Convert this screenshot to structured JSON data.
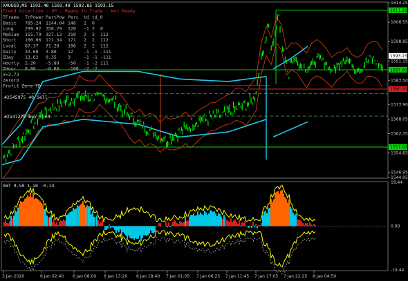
{
  "header": {
    "title": "XAUUSD,M5  1593.46 1593.48 1592.85 1593.15",
    "trend_status": "Trend Direction : UP  ;  Ready To Trade : Not Ready"
  },
  "stats_table": {
    "headers": [
      "TFrame",
      "TrPower",
      "PartPow",
      "Perc",
      "td",
      "td_0"
    ],
    "rows": [
      [
        "Basic",
        "785.24",
        "1144.04",
        "146",
        "2",
        "0"
      ],
      [
        "Long",
        "299.92",
        "358.79",
        "120",
        "-1",
        "2",
        "0"
      ],
      [
        "Medium",
        "155.79",
        "327.13",
        "210",
        "2",
        "2",
        "112"
      ],
      [
        "Short",
        "100.06",
        "171.34",
        "171",
        "2",
        "2",
        "112"
      ],
      [
        "Local",
        "67.37",
        "71.28",
        "106",
        "2",
        "2",
        "112"
      ],
      [
        "Daily",
        "33.68",
        "3.80",
        "12",
        "-1",
        "-1",
        "-111"
      ],
      [
        "IDay",
        "13.62",
        "0.35",
        "3",
        "-1",
        "-1",
        "-111"
      ],
      [
        "Hourly",
        "2.20",
        "-5.89",
        "-50",
        "-1",
        "-2",
        "111"
      ],
      [
        "IHour",
        "0.86",
        "-0.86",
        "-100",
        "-2",
        "-2",
        ""
      ]
    ],
    "extra_lines": [
      "V=3.73",
      "ZeroTD",
      "Profit Zero TD"
    ]
  },
  "chart_notes": [
    "#2545975 40 Sell",
    "#2547279 Buy 0.04"
  ],
  "colors": {
    "background": "#000000",
    "price": "#00ff00",
    "channel": "#1ec8e6",
    "level_green": "#00e000",
    "level_red": "#e02020",
    "bands": "#c83c14",
    "osc_cyan": "#00c8e6",
    "osc_orange": "#ff6400",
    "osc_red": "#e01e1e",
    "osc_yellow": "#ffff00"
  },
  "price_axis": {
    "ticks": [
      "1614.25",
      "1606.55",
      "1598.85",
      "1591.15",
      "1583.50",
      "1573.90",
      "1568.05",
      "1562.35",
      "1554.65",
      "1546.95",
      "1544.95"
    ],
    "labels": [
      {
        "text": "1611.29",
        "value": 1611.29,
        "color": "#00e000"
      },
      {
        "text": "1593.15",
        "value": 1593.15,
        "color": "#ffffff"
      },
      {
        "text": "1587.65",
        "value": 1587.65,
        "color": "#00e000"
      },
      {
        "text": "1580.00",
        "value": 1580.0,
        "color": "#e02020"
      },
      {
        "text": "1557.00",
        "value": 1557.0,
        "color": "#00e000"
      }
    ],
    "ylim": [
      1544.95,
      1614.25
    ]
  },
  "oscillator": {
    "title": "SWT 9.50 1.10 -0.14",
    "axis_ticks": [
      "19.44",
      "0.00",
      "-19.44"
    ],
    "ylim": [
      -19.44,
      19.44
    ]
  },
  "time_axis": {
    "labels": [
      "3 Jan 2020",
      "6 Jan 02:40",
      "6 Jan 08:00",
      "6 Jan 13:20",
      "6 Jan 18:40",
      "7 Jan 01:05",
      "7 Jan 06:25",
      "7 Jan 11:45",
      "7 Jan 17:05",
      "7 Jan 22:25",
      "8 Jan 04:50"
    ]
  },
  "chart_data": {
    "type": "line",
    "symbol": "XAUUSD",
    "timeframe": "M5",
    "x": [
      "3 Jan 2020",
      "6 Jan 02:40",
      "6 Jan 08:00",
      "6 Jan 13:20",
      "6 Jan 18:40",
      "7 Jan 01:05",
      "7 Jan 06:25",
      "7 Jan 11:45",
      "7 Jan 17:05",
      "7 Jan 22:25",
      "8 Jan 04:50"
    ],
    "series": [
      {
        "values": [
          1552.5,
          1570.5,
          1577.0,
          1576.5,
          1566.0,
          1559.5,
          1567.5,
          1570.0,
          1575.5,
          1606.0,
          1593.15
        ]
      }
    ],
    "ylim": [
      1544.95,
      1614.25
    ],
    "horizontal_levels": [
      1611.29,
      1587.65,
      1580.0,
      1557.0
    ],
    "last_price": 1593.15
  }
}
